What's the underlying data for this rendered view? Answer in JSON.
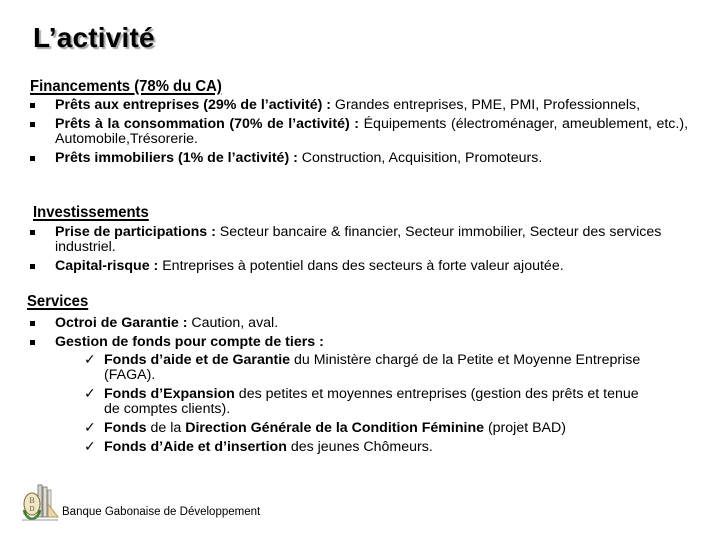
{
  "slide": {
    "title": "L’activité"
  },
  "sections": {
    "financements": {
      "heading": "Financements (78% du CA)",
      "items": [
        {
          "bold": "Prêts aux entreprises (29% de l’activité) :",
          "text": " Grandes entreprises, PME, PMI, Professionnels,"
        },
        {
          "bold": "Prêts à la consommation (70% de l’activité) :",
          "text": " Équipements (électroménager, ameublement, etc.), Automobile,Trésorerie."
        },
        {
          "bold": "Prêts immobiliers (1% de l’activité) :",
          "text": " Construction, Acquisition, Promoteurs."
        }
      ]
    },
    "investissements": {
      "heading": "Investissements",
      "items": [
        {
          "bold": "Prise de participations :",
          "text": " Secteur bancaire & financier, Secteur immobilier, Secteur des services industriel."
        },
        {
          "bold": "Capital-risque :",
          "text": " Entreprises à potentiel dans des secteurs à forte valeur ajoutée."
        }
      ]
    },
    "services": {
      "heading": "Services",
      "items": [
        {
          "bold": "Octroi de Garantie :",
          "text": " Caution, aval."
        },
        {
          "bold": "Gestion de fonds pour compte de tiers :",
          "text": "",
          "subitems": [
            {
              "parts": [
                {
                  "bold": "Fonds d’aide et de Garantie"
                },
                {
                  "text": " du Ministère chargé de la Petite et Moyenne Entreprise (FAGA)."
                }
              ]
            },
            {
              "parts": [
                {
                  "bold": "Fonds d’Expansion"
                },
                {
                  "text": " des petites et moyennes entreprises (gestion des prêts et tenue de comptes clients)."
                }
              ]
            },
            {
              "parts": [
                {
                  "bold": "Fonds"
                },
                {
                  "text": " de la "
                },
                {
                  "bold": "Direction Générale de la Condition Féminine"
                },
                {
                  "text": " (projet BAD)"
                }
              ]
            },
            {
              "parts": [
                {
                  "bold": "Fonds d’Aide et d’insertion"
                },
                {
                  "text": " des jeunes Chômeurs."
                }
              ]
            }
          ]
        }
      ]
    }
  },
  "icons": {
    "bullet": "square-bullet-icon",
    "check": "✓",
    "logo": "bgd-logo-icon"
  },
  "footer": {
    "organization": "Banque Gabonaise de Développement"
  },
  "colors": {
    "text": "#000000",
    "title_shadow": "#a8a8a8",
    "logo_green": "#3d7a2a",
    "logo_tan": "#b59a5a"
  }
}
